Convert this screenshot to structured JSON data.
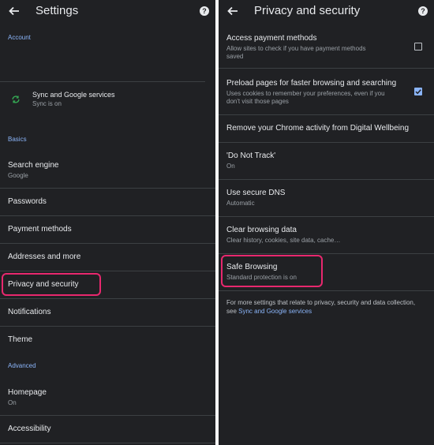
{
  "left": {
    "title": "Settings",
    "section_account": "Account",
    "sync": {
      "label": "Sync and Google services",
      "sub": "Sync is on"
    },
    "section_basics": "Basics",
    "search_engine": {
      "label": "Search engine",
      "sub": "Google"
    },
    "passwords": "Passwords",
    "payment_methods": "Payment methods",
    "addresses": "Addresses and more",
    "privacy": "Privacy and security",
    "notifications": "Notifications",
    "theme": "Theme",
    "section_advanced": "Advanced",
    "homepage": {
      "label": "Homepage",
      "sub": "On"
    },
    "accessibility": "Accessibility"
  },
  "right": {
    "title": "Privacy and security",
    "access_payment": {
      "label": "Access payment methods",
      "sub1": "Allow sites to check if you have payment methods",
      "sub2": "saved",
      "checked": false
    },
    "preload": {
      "label": "Preload pages for faster browsing and searching",
      "sub1": "Uses cookies to remember your preferences, even if you",
      "sub2": "don't visit those pages",
      "checked": true
    },
    "remove_activity": "Remove your Chrome activity from Digital Wellbeing",
    "dnt": {
      "label": "'Do Not Track'",
      "sub": "On"
    },
    "secure_dns": {
      "label": "Use secure DNS",
      "sub": "Automatic"
    },
    "clear_data": {
      "label": "Clear browsing data",
      "sub": "Clear history, cookies, site data, cache…"
    },
    "safe_browsing": {
      "label": "Safe Browsing",
      "sub": "Standard protection is on"
    },
    "footer_text": "For more settings that relate to privacy, security and data collection, see ",
    "footer_link": "Sync and Google services"
  },
  "icons": {
    "back": "arrow-back-icon",
    "help": "help-icon",
    "sync": "sync-icon",
    "check": "check-icon"
  },
  "colors": {
    "background": "#202124",
    "accent": "#8ab4f8",
    "highlight": "#e8286e",
    "sync_icon": "#34a853"
  }
}
